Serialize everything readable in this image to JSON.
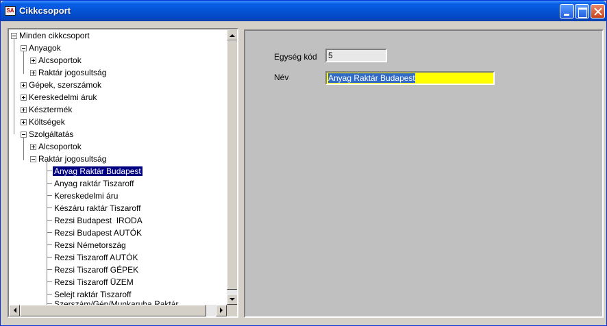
{
  "window": {
    "title": "Cikkcsoport",
    "icon": "app-icon"
  },
  "tree": {
    "root": {
      "label": "Minden cikkcsoport",
      "state": "expanded"
    },
    "nodes": [
      {
        "label": "Anyagok",
        "level": 1,
        "state": "expanded"
      },
      {
        "label": "Alcsoportok",
        "level": 2,
        "state": "collapsed"
      },
      {
        "label": "Raktár jogosultság",
        "level": 2,
        "state": "collapsed"
      },
      {
        "label": "Gépek, szerszámok",
        "level": 1,
        "state": "collapsed"
      },
      {
        "label": "Kereskedelmi áruk",
        "level": 1,
        "state": "collapsed"
      },
      {
        "label": "Késztermék",
        "level": 1,
        "state": "collapsed"
      },
      {
        "label": "Költségek",
        "level": 1,
        "state": "collapsed"
      },
      {
        "label": "Szolgáltatás",
        "level": 1,
        "state": "expanded"
      },
      {
        "label": "Alcsoportok",
        "level": 2,
        "state": "collapsed"
      },
      {
        "label": "Raktár jogosultság",
        "level": 2,
        "state": "expanded"
      },
      {
        "label": "Anyag Raktár Budapest",
        "level": 3,
        "state": "leaf",
        "selected": true
      },
      {
        "label": "Anyag raktár Tiszaroff",
        "level": 3,
        "state": "leaf"
      },
      {
        "label": "Kereskedelmi áru",
        "level": 3,
        "state": "leaf"
      },
      {
        "label": "Készáru raktár Tiszaroff",
        "level": 3,
        "state": "leaf"
      },
      {
        "label": "Rezsi Budapest  IRODA",
        "level": 3,
        "state": "leaf"
      },
      {
        "label": "Rezsi Budapest AUTÓK",
        "level": 3,
        "state": "leaf"
      },
      {
        "label": "Rezsi Németország",
        "level": 3,
        "state": "leaf"
      },
      {
        "label": "Rezsi Tiszaroff AUTÓK",
        "level": 3,
        "state": "leaf"
      },
      {
        "label": "Rezsi Tiszaroff GÉPEK",
        "level": 3,
        "state": "leaf"
      },
      {
        "label": "Rezsi Tiszaroff ÜZEM",
        "level": 3,
        "state": "leaf"
      },
      {
        "label": "Selejt raktár Tiszaroff",
        "level": 3,
        "state": "leaf"
      },
      {
        "label": "Szerszám/Gép/Munkaruha Raktár",
        "level": 3,
        "state": "leaf"
      }
    ]
  },
  "form": {
    "unit_code_label": "Egység kód",
    "unit_code_value": "5",
    "name_label": "Név",
    "name_value": "Anyag Raktár Budapest"
  },
  "colors": {
    "title_bar": "#0453d4",
    "selection": "#000080",
    "text_highlight": "#316ac5",
    "name_field": "#ffff00"
  }
}
